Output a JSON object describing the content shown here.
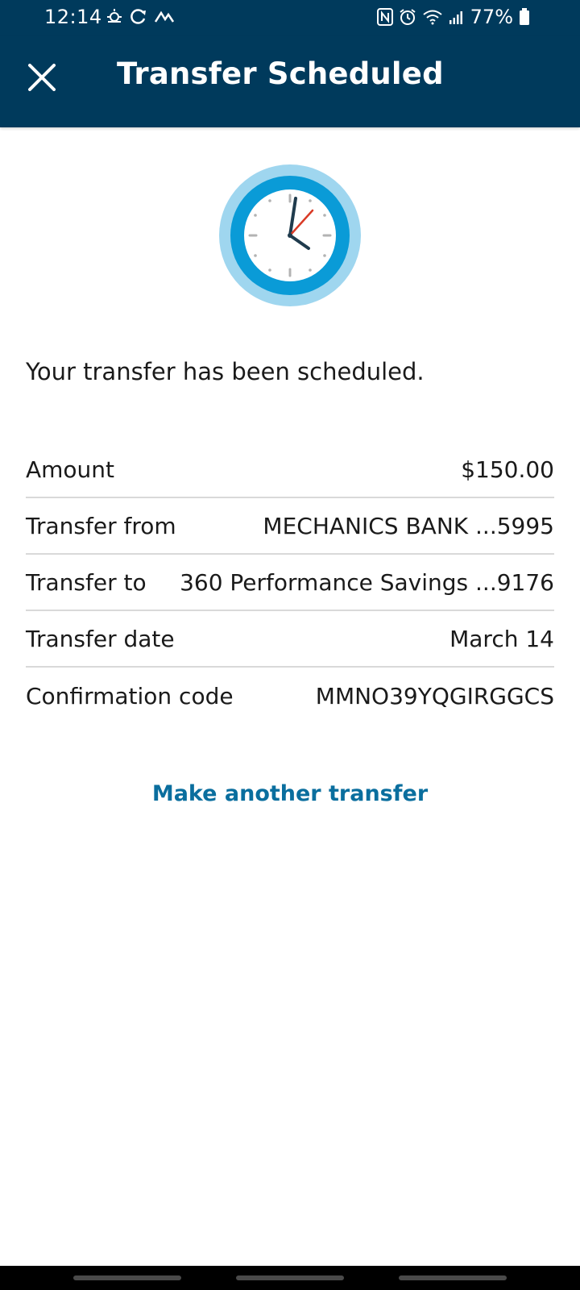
{
  "status_bar": {
    "time": "12:14",
    "battery": "77%"
  },
  "header": {
    "title": "Transfer Scheduled"
  },
  "message": "Your transfer has been scheduled.",
  "details": [
    {
      "label": "Amount",
      "value": "$150.00"
    },
    {
      "label": "Transfer from",
      "value": "MECHANICS BANK ...5995"
    },
    {
      "label": "Transfer to",
      "value": "360 Performance Savings ...9176"
    },
    {
      "label": "Transfer date",
      "value": "March 14"
    },
    {
      "label": "Confirmation code",
      "value": "MMNO39YQGIRGGCS"
    }
  ],
  "actions": {
    "another_transfer": "Make another transfer"
  },
  "icons": {
    "close": "close-icon",
    "clock": "clock-icon"
  },
  "colors": {
    "header_bg": "#003a5c",
    "link": "#0a6e9e",
    "clock_outer": "#9fd6ef",
    "clock_ring": "#0a9bd7"
  }
}
